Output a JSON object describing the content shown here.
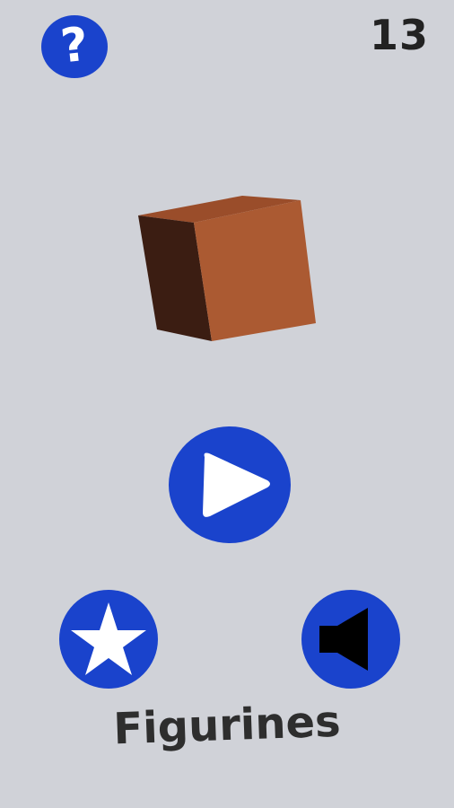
{
  "score": "13",
  "title": "Figurines",
  "help_button": {
    "glyph": "?"
  },
  "icons": {
    "help": "question-mark-icon",
    "play": "play-icon",
    "favorites": "star-icon",
    "sound": "speaker-icon"
  },
  "colors": {
    "background": "#d0d2d8",
    "button": "#1a43cc",
    "icon": "#ffffff",
    "speaker": "#000000",
    "cube_front": "#ab5a32",
    "cube_side": "#3b1d12",
    "cube_top": "#9a4d2a"
  }
}
